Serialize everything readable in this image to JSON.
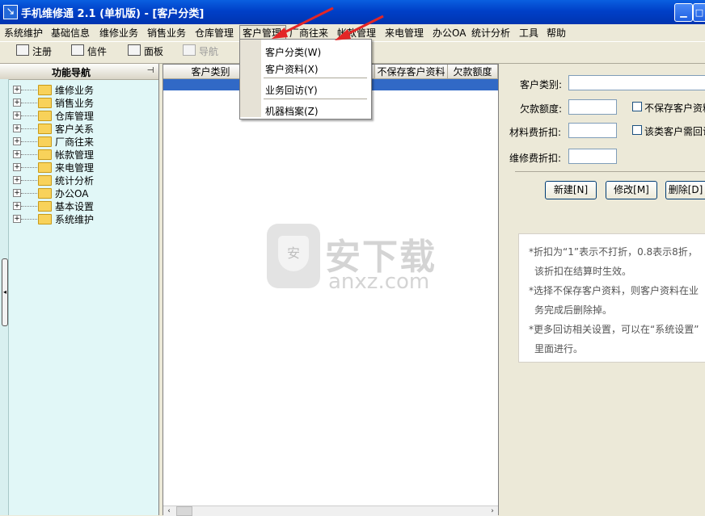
{
  "window": {
    "title": "手机维修通 2.1 (单机版) - [客户分类]"
  },
  "menubar": {
    "items": [
      "系统维护",
      "基础信息",
      "维修业务",
      "销售业务",
      "仓库管理",
      "客户管理",
      "厂商往来",
      "帐款管理",
      "来电管理",
      "办公OA",
      "统计分析",
      "工具",
      "帮助"
    ]
  },
  "toolbar": {
    "register": "注册",
    "mail": "信件",
    "panel": "面板",
    "nav": "导航"
  },
  "nav": {
    "title": "功能导航",
    "items": [
      "维修业务",
      "销售业务",
      "仓库管理",
      "客户关系",
      "厂商往来",
      "帐款管理",
      "来电管理",
      "统计分析",
      "办公OA",
      "基本设置",
      "系统维护"
    ]
  },
  "grid": {
    "columns": [
      "客户类别",
      "不保存客户资料",
      "欠款额度"
    ]
  },
  "dropdown": {
    "items": [
      "客户分类(W)",
      "客户资料(X)",
      "业务回访(Y)",
      "机器档案(Z)"
    ]
  },
  "form": {
    "category_label": "客户类别:",
    "debt_label": "欠款额度:",
    "material_label": "材料费折扣:",
    "repair_label": "维修费折扣:",
    "no_save_label": "不保存客户资料",
    "revisit_label": "该类客户需回访",
    "new_button": "新建[N]",
    "edit_button": "修改[M]",
    "delete_button": "删除[D]"
  },
  "notes": [
    "*折扣为“1”表示不打折，0.8表示8折，",
    "该折扣在结算时生效。",
    "*选择不保存客户资料，则客户资料在业",
    "务完成后删除掉。",
    "*更多回访相关设置，可以在“系统设置”",
    "里面进行。"
  ],
  "watermark": {
    "text": "安下载",
    "domain": "anxz.com"
  }
}
